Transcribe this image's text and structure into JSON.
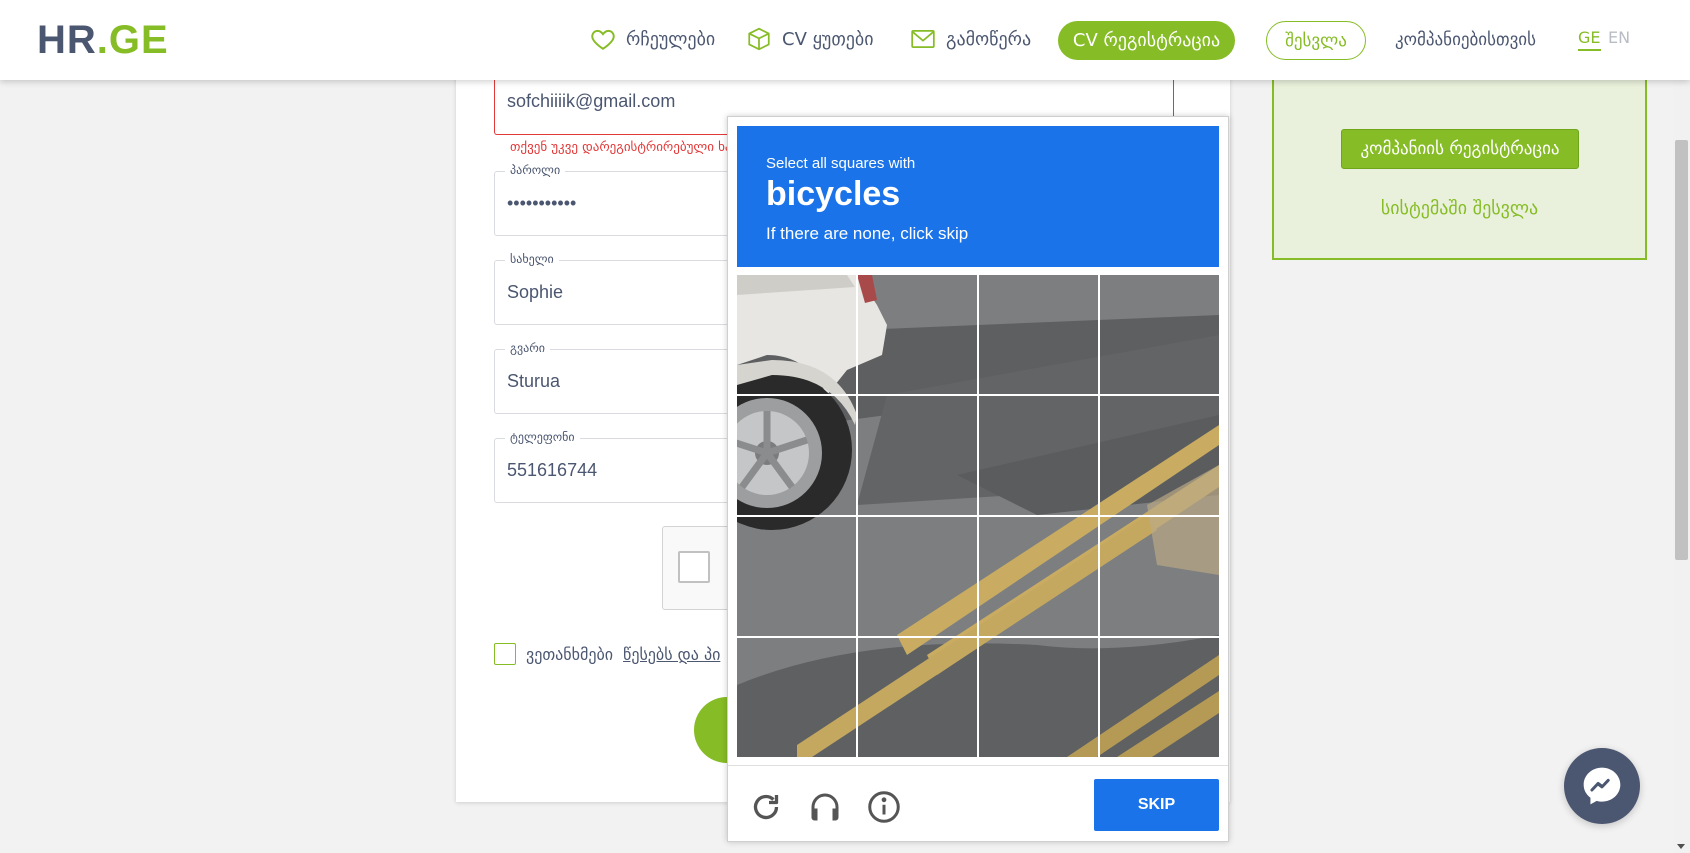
{
  "header": {
    "logo_hr": "HR",
    "logo_ge": ".GE",
    "nav": {
      "favorites": "რჩეულები",
      "cv_boxes": "CV ყუთები",
      "subscribe": "გამოწერა",
      "cv_register": "CV რეგისტრაცია",
      "login": "შესვლა",
      "for_companies": "კომპანიებისთვის"
    },
    "lang": {
      "ge": "GE",
      "en": "EN"
    }
  },
  "form": {
    "email_value": "sofchiiiik@gmail.com",
    "email_error": "თქვენ უკვე დარეგისტრირებული ხართ",
    "password_label": "პაროლი",
    "password_value": "•••••••••••",
    "name_label": "სახელი",
    "name_value": "Sophie",
    "surname_label": "გვარი",
    "surname_value": "Sturua",
    "phone_label": "ტელეფონი",
    "phone_value": "551616744",
    "agree_text": "ვეთანხმები",
    "terms_link": "წესებს და პი"
  },
  "side_panel": {
    "company_register": "კომპანიის რეგისტრაცია",
    "system_login": "სისტემაში შესვლა"
  },
  "captcha": {
    "line1": "Select all squares with",
    "target": "bicycles",
    "line3": "If there are none, click skip",
    "skip_label": "SKIP",
    "icons": [
      "refresh-icon",
      "headphones-icon",
      "info-icon"
    ]
  },
  "colors": {
    "brand_green": "#86bc25",
    "brand_navy": "#4b5670",
    "captcha_blue": "#1a73e8",
    "error_red": "#e23838"
  }
}
